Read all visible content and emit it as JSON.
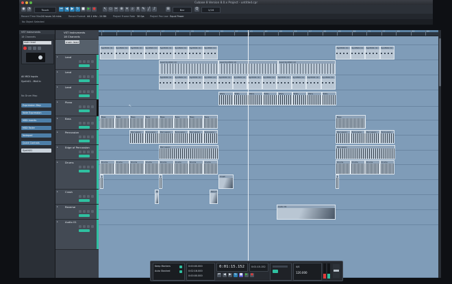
{
  "window": {
    "title": "Cubase 8 Version 8.0.x Project - untitled.cpr"
  },
  "toolbar": {
    "mode": "Touch",
    "grid": "Bar",
    "zoom_readout": "1/16",
    "play_symbol": "▶",
    "stop_symbol": "■",
    "record_symbol": "●"
  },
  "statusbar": {
    "items": [
      "Record Time Max",
      "24 hours 14 mins",
      "Record Format",
      "44.1 kHz - 24 Bit",
      "Project Frame Rate",
      "30 fps",
      "Project Pan Law",
      "Equal Power"
    ]
  },
  "infoline": {
    "text": "No Object Selected"
  },
  "inspector": {
    "header": "VST Instruments",
    "sub_header": "18 Channels",
    "track_name": "main lead",
    "routing_label": "All MIDI Inputs",
    "output_label": "Synth01 - Midi In",
    "drum_map": "No Drum Map",
    "sections": [
      "Expression Map",
      "Note Expression",
      "MIDI Inserts",
      "MIDI Fader",
      "Notepad",
      "Quick Controls",
      "Synth01"
    ]
  },
  "tracks": [
    {
      "name": "Lead"
    },
    {
      "name": "Lead"
    },
    {
      "name": "Lead"
    },
    {
      "name": "Piano"
    },
    {
      "name": "Bass"
    },
    {
      "name": "Percussion"
    },
    {
      "name": "Edge of Percussion"
    },
    {
      "name": "Drums"
    },
    {
      "name": "Crash"
    },
    {
      "name": "Reverse"
    },
    {
      "name": "Audio 01"
    }
  ],
  "ruler": {
    "marks": [
      "1",
      "5",
      "9",
      "13",
      "17",
      "21",
      "25",
      "29",
      "33",
      "37",
      "41",
      "45",
      "49",
      "53",
      "57",
      "61",
      "65",
      "69",
      "73",
      "77",
      "81",
      "85",
      "89",
      "93",
      "97"
    ]
  },
  "events": {
    "synth_label": "Synth01 (1)",
    "lead_label": "Lead Synth01 (2)",
    "pads_label": "PADs",
    "bass_label": "Bass",
    "perc_label": "Percussion",
    "drums_label": "Drums",
    "crash_label": "Crash",
    "reverse_label": "Reverse",
    "audio_label": "Audio 01"
  },
  "transport": {
    "left_label": "Keep Markers",
    "right_label": "Auto Stacked",
    "time_main": "0:01:15.152",
    "time_small": "0:01:15.152",
    "tempo": "120.000",
    "signature": "4/4",
    "position_a": "0:00:00.000",
    "position_b": "0:02:16.000",
    "position_c": "0:00:00.000"
  },
  "colors": {
    "arrange_bg": "#7f9cb8",
    "accent": "#2fc0a0",
    "record": "#e23a3a",
    "play": "#3fc63f"
  }
}
